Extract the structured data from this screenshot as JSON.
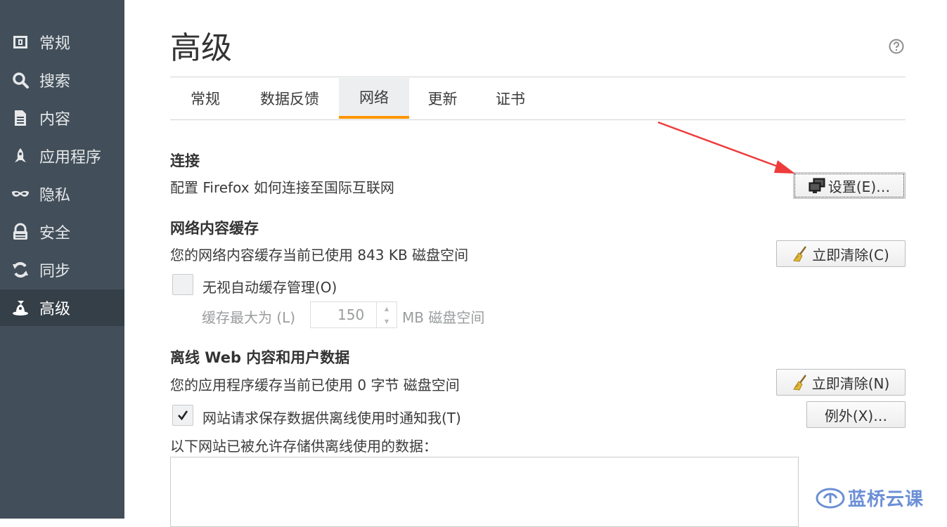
{
  "sidebar": {
    "items": [
      {
        "label": "常规",
        "icon": "general-icon"
      },
      {
        "label": "搜索",
        "icon": "search-icon"
      },
      {
        "label": "内容",
        "icon": "document-icon"
      },
      {
        "label": "应用程序",
        "icon": "rocket-icon"
      },
      {
        "label": "隐私",
        "icon": "mask-icon"
      },
      {
        "label": "安全",
        "icon": "lock-icon"
      },
      {
        "label": "同步",
        "icon": "sync-icon"
      },
      {
        "label": "高级",
        "icon": "wizard-hat-icon",
        "active": true
      }
    ]
  },
  "page": {
    "title": "高级"
  },
  "tabs": [
    {
      "label": "常规"
    },
    {
      "label": "数据反馈"
    },
    {
      "label": "网络",
      "active": true
    },
    {
      "label": "更新"
    },
    {
      "label": "证书"
    }
  ],
  "connection": {
    "title": "连接",
    "desc": "配置 Firefox 如何连接至国际互联网",
    "settings_button": "设置(E)…"
  },
  "cache": {
    "title": "网络内容缓存",
    "desc": "您的网络内容缓存当前已使用 843 KB 磁盘空间",
    "clear_button": "立即清除(C)",
    "override_label": "无视自动缓存管理(O)",
    "override_checked": false,
    "limit_label": "缓存最大为 (L)",
    "limit_value": "150",
    "limit_unit": "MB 磁盘空间"
  },
  "offline": {
    "title": "离线 Web 内容和用户数据",
    "desc": "您的应用程序缓存当前已使用 0 字节 磁盘空间",
    "clear_button": "立即清除(N)",
    "notify_label": "网站请求保存数据供离线使用时通知我(T)",
    "notify_checked": true,
    "exceptions_button": "例外(X)…",
    "list_label": "以下网站已被允许存储供离线使用的数据："
  },
  "watermark": {
    "text": "蓝桥云课"
  },
  "colors": {
    "sidebar_bg": "#424f5a",
    "sidebar_active_bg": "#343f48",
    "tab_accent": "#ff9500",
    "annotation_arrow": "#ee3b3b"
  }
}
